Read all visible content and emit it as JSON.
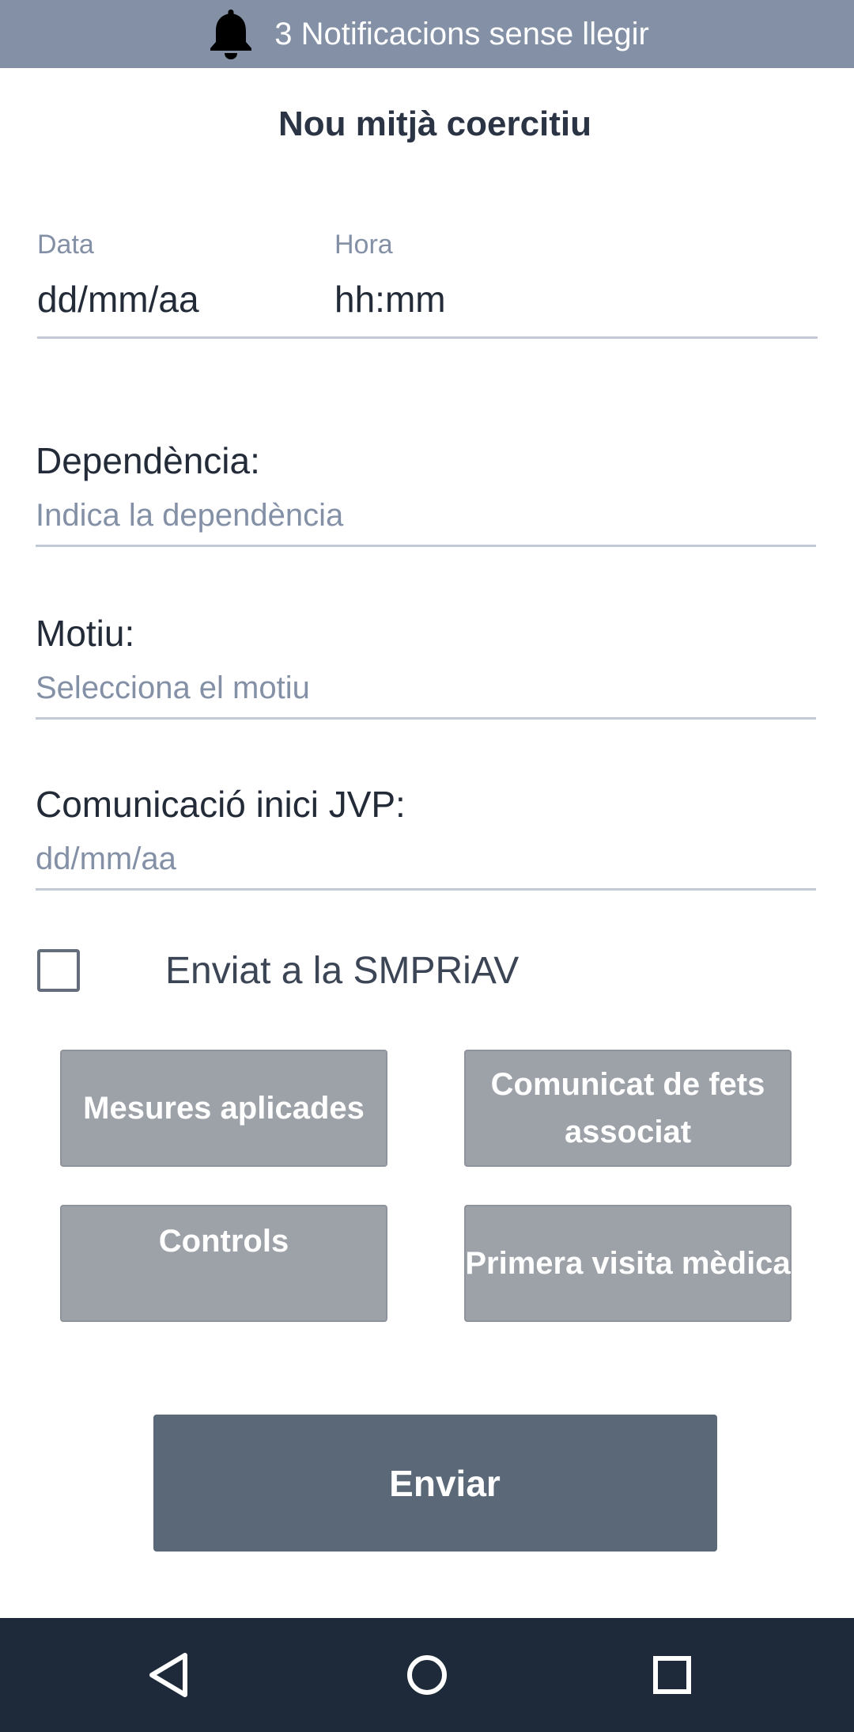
{
  "notification": {
    "text": "3 Notificacions sense llegir",
    "icon": "bell-icon"
  },
  "page": {
    "title": "Nou mitjà coercitiu"
  },
  "date_time": {
    "date_label": "Data",
    "date_value": "dd/mm/aa",
    "time_label": "Hora",
    "time_value": "hh:mm"
  },
  "fields": {
    "dependencia": {
      "label": "Dependència:",
      "placeholder": "Indica la dependència"
    },
    "motiu": {
      "label": "Motiu:",
      "placeholder": "Selecciona el motiu"
    },
    "comunicacio": {
      "label": "Comunicació inici JVP:",
      "placeholder": "dd/mm/aa"
    }
  },
  "checkbox": {
    "label": "Enviat a la SMPRiAV",
    "checked": false
  },
  "buttons": {
    "mesures": "Mesures aplicades",
    "comunicat": "Comunicat de fets associat",
    "controls": "Controls",
    "visita": "Primera visita mèdica",
    "enviar": "Enviar"
  },
  "nav": {
    "back": "back-icon",
    "home": "home-icon",
    "recents": "recents-icon"
  },
  "colors": {
    "notification_bg": "#8390a6",
    "secondary_button": "#9da1a8",
    "primary_button": "#5a6878",
    "nav_bar": "#1e2a3a"
  }
}
